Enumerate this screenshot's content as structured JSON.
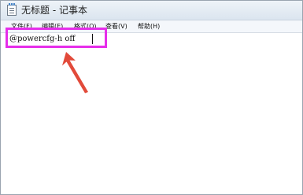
{
  "window": {
    "title": "无标题 - 记事本"
  },
  "menu": {
    "file": "文件(F)",
    "edit": "编辑(E)",
    "format": "格式(O)",
    "view": "查看(V)",
    "help": "帮助(H)"
  },
  "editor": {
    "content": "@powercfg-h off"
  },
  "colors": {
    "highlight": "#e62eea",
    "arrow": "#e24a3a"
  },
  "icons": {
    "app": "notepad-icon",
    "annotation": "arrow-annotation"
  }
}
